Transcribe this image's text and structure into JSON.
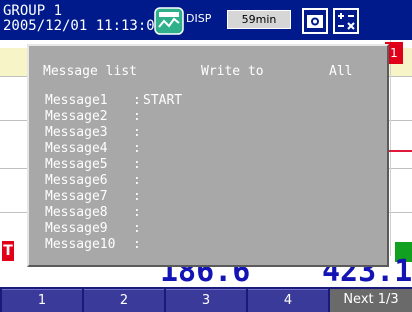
{
  "header": {
    "group_label": "GROUP 1",
    "datetime": "2005/12/01 11:13:03",
    "disp_label": "DISP",
    "interval": "59min"
  },
  "marker_top": "1",
  "marker_trip": "T",
  "dialog": {
    "title": "Message list",
    "write_to_label": "Write to",
    "target": "All",
    "messages": [
      {
        "name": "Message1",
        "sep": ":",
        "text": "START"
      },
      {
        "name": "Message2",
        "sep": ":",
        "text": ""
      },
      {
        "name": "Message3",
        "sep": ":",
        "text": ""
      },
      {
        "name": "Message4",
        "sep": ":",
        "text": ""
      },
      {
        "name": "Message5",
        "sep": ":",
        "text": ""
      },
      {
        "name": "Message6",
        "sep": ":",
        "text": ""
      },
      {
        "name": "Message7",
        "sep": ":",
        "text": ""
      },
      {
        "name": "Message8",
        "sep": ":",
        "text": ""
      },
      {
        "name": "Message9",
        "sep": ":",
        "text": ""
      },
      {
        "name": "Message10",
        "sep": ":",
        "text": ""
      }
    ]
  },
  "values": {
    "v1": "186.6",
    "v2": "423.1"
  },
  "softkeys": [
    {
      "label": "1"
    },
    {
      "label": "2"
    },
    {
      "label": "3"
    },
    {
      "label": "4"
    }
  ],
  "next_key": "Next 1/3",
  "colors": {
    "header_bg": "#001a8c",
    "dialog_bg": "#a8a8a8",
    "value_text": "#1414b4",
    "alarm_red": "#e00018"
  }
}
